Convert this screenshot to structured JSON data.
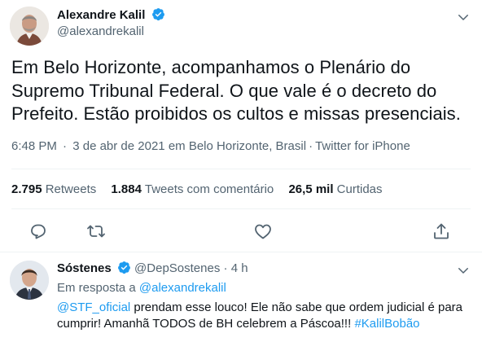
{
  "tweet": {
    "author_name": "Alexandre Kalil",
    "author_handle": "@alexandrekalil",
    "text": "Em Belo Horizonte, acompanhamos o Plenário do Supremo Tribunal Federal. O que vale é o decreto do Prefeito. Estão proibidos os cultos e missas presenciais.",
    "time": "6:48 PM",
    "date": "3 de abr de 2021",
    "location": "em Belo Horizonte, Brasil",
    "source": "Twitter for iPhone",
    "separator": "·"
  },
  "stats": [
    {
      "count": "2.795",
      "label": "Retweets"
    },
    {
      "count": "1.884",
      "label": "Tweets com comentário"
    },
    {
      "count": "26,5 mil",
      "label": "Curtidas"
    }
  ],
  "actions": [
    "reply-icon",
    "retweet-icon",
    "like-icon",
    "share-icon"
  ],
  "reply": {
    "author_name": "Sóstenes",
    "author_handle": "@DepSostenes",
    "time": "4 h",
    "separator": "·",
    "in_reply_prefix": "Em resposta a",
    "in_reply_handle": "@alexandrekalil",
    "mention": "@STF_oficial",
    "text": "prendam esse louco! Ele não sabe que ordem judicial é para cumprir! Amanhã TODOS de BH celebrem a Páscoa!!!",
    "hashtag": "#KalilBobão"
  },
  "colors": {
    "text": "#0f1419",
    "secondary": "#536471",
    "accent": "#1d9bf0",
    "divider": "#eff3f4"
  }
}
